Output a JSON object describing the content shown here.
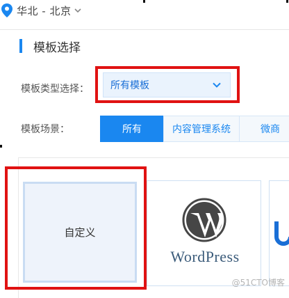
{
  "region": {
    "label": "华北 - 北京",
    "pin_icon": "location-pin-icon",
    "chevron_icon": "chevron-down-icon"
  },
  "section": {
    "title": "模板选择"
  },
  "template_type": {
    "label": "模板类型选择：",
    "selected": "所有模板"
  },
  "template_scene": {
    "label": "模板场景：",
    "tabs": [
      {
        "label": "所有",
        "active": true
      },
      {
        "label": "内容管理系统",
        "active": false
      },
      {
        "label": "微商",
        "active": false
      }
    ]
  },
  "templates": {
    "custom_label": "自定义",
    "wordpress_wordmark": "WordPress"
  },
  "watermark": "@51CTO博客",
  "colors": {
    "accent": "#1a87f0",
    "highlight": "#e01212",
    "select_bg": "#eaf3fd",
    "wordpress": "#3b5b7a"
  }
}
